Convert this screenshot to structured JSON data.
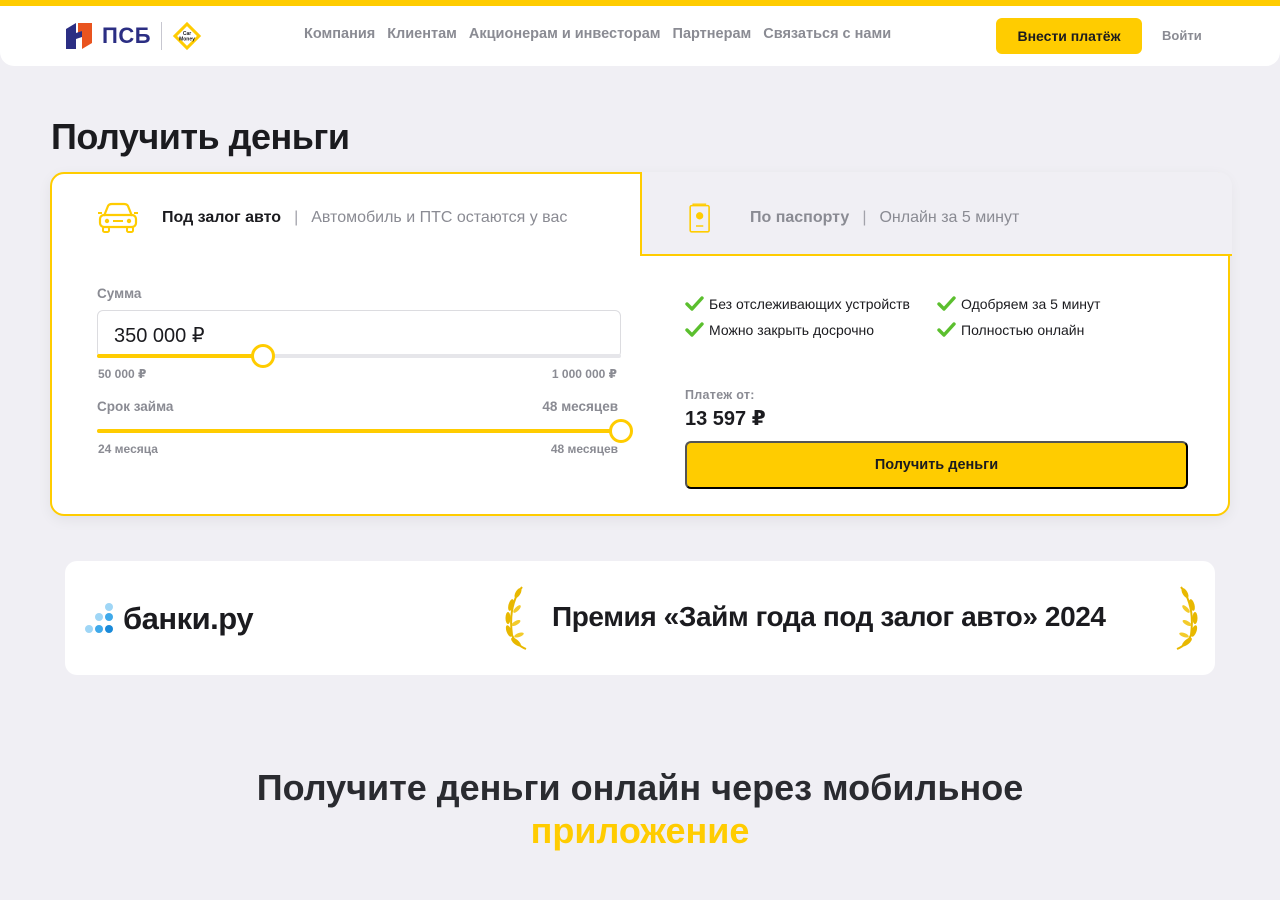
{
  "header": {
    "logo_text": "ПСБ",
    "logo_cm_text": "Car Money",
    "nav": [
      "Компания",
      "Клиентам",
      "Акционерам и инвесторам",
      "Партнерам",
      "Связаться с нами"
    ],
    "pay_button": "Внести платёж",
    "login": "Войти"
  },
  "page_title": "Получить деньги",
  "tabs": [
    {
      "title": "Под залог авто",
      "separator": "|",
      "subtitle": "Автомобиль и ПТС остаются у вас",
      "active": true,
      "icon": "car-icon"
    },
    {
      "title": "По паспорту",
      "separator": "|",
      "subtitle": "Онлайн за 5 минут",
      "active": false,
      "icon": "passport-icon"
    }
  ],
  "calculator": {
    "amount_label": "Сумма",
    "amount_value": "350 000 ₽",
    "amount_min": "50 000 ₽",
    "amount_max": "1 000 000 ₽",
    "amount_fraction": 0.316,
    "term_label": "Срок займа",
    "term_value": "48 месяцев",
    "term_min": "24 месяца",
    "term_max": "48 месяцев",
    "term_fraction": 1.0
  },
  "features": [
    "Без отслеживающих устройств",
    "Одобряем за 5 минут",
    "Можно закрыть досрочно",
    "Полностью онлайн"
  ],
  "payment": {
    "label": "Платеж от:",
    "value": "13 597 ₽"
  },
  "cta_button": "Получить деньги",
  "award": {
    "brand": "банки.ру",
    "text": "Премия «Займ года под залог авто» 2024"
  },
  "promo": {
    "line1": "Получите деньги онлайн через мобильное",
    "line2": "приложение"
  },
  "colors": {
    "accent": "#ffcc00",
    "brand_blue": "#2b2e83",
    "brand_red": "#e9541f",
    "check_green": "#5bbf2e"
  }
}
